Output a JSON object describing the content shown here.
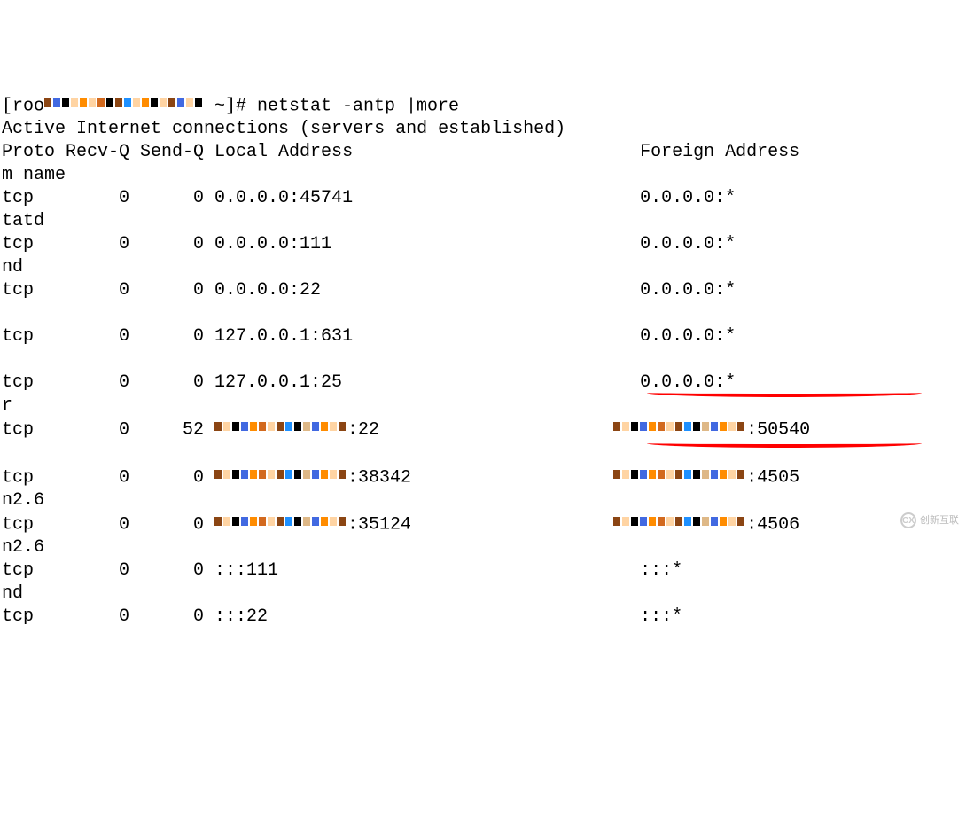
{
  "prompt": {
    "user_host_prefix": "[roo",
    "user_host_suffix": " ~]# ",
    "command": "netstat -antp |more"
  },
  "header": {
    "title": "Active Internet connections (servers and established)",
    "col_proto": "Proto",
    "col_recvq": "Recv-Q",
    "col_sendq": "Send-Q",
    "col_local": "Local Address",
    "col_foreign": "Foreign Address",
    "wrap_line": "m name"
  },
  "rows": [
    {
      "proto": "tcp",
      "recvq": "0",
      "sendq": "0",
      "local": "0.0.0.0:45741",
      "foreign": "0.0.0.0:*",
      "wrap": "tatd",
      "censored_local": false,
      "censored_foreign": false
    },
    {
      "proto": "tcp",
      "recvq": "0",
      "sendq": "0",
      "local": "0.0.0.0:111",
      "foreign": "0.0.0.0:*",
      "wrap": "nd",
      "censored_local": false,
      "censored_foreign": false
    },
    {
      "proto": "tcp",
      "recvq": "0",
      "sendq": "0",
      "local": "0.0.0.0:22",
      "foreign": "0.0.0.0:*",
      "wrap": "",
      "censored_local": false,
      "censored_foreign": false
    },
    {
      "proto": "tcp",
      "recvq": "0",
      "sendq": "0",
      "local": "127.0.0.1:631",
      "foreign": "0.0.0.0:*",
      "wrap": "",
      "censored_local": false,
      "censored_foreign": false
    },
    {
      "proto": "tcp",
      "recvq": "0",
      "sendq": "0",
      "local": "127.0.0.1:25",
      "foreign": "0.0.0.0:*",
      "wrap": "r",
      "censored_local": false,
      "censored_foreign": false
    },
    {
      "proto": "tcp",
      "recvq": "0",
      "sendq": "52",
      "local": ":22",
      "foreign": ":50540",
      "wrap": "",
      "censored_local": true,
      "censored_foreign": true
    },
    {
      "proto": "tcp",
      "recvq": "0",
      "sendq": "0",
      "local": ":38342",
      "foreign": ":4505",
      "wrap": "n2.6",
      "censored_local": true,
      "censored_foreign": true,
      "underline": true
    },
    {
      "proto": "tcp",
      "recvq": "0",
      "sendq": "0",
      "local": ":35124",
      "foreign": ":4506",
      "wrap": "n2.6",
      "censored_local": true,
      "censored_foreign": true,
      "underline": true
    },
    {
      "proto": "tcp",
      "recvq": "0",
      "sendq": "0",
      "local": ":::111",
      "foreign": ":::*",
      "wrap": "nd",
      "censored_local": false,
      "censored_foreign": false
    },
    {
      "proto": "tcp",
      "recvq": "0",
      "sendq": "0",
      "local": ":::22",
      "foreign": ":::*",
      "wrap": "",
      "censored_local": false,
      "censored_foreign": false
    }
  ],
  "watermark": {
    "logo": "CX",
    "text": "创新互联"
  }
}
